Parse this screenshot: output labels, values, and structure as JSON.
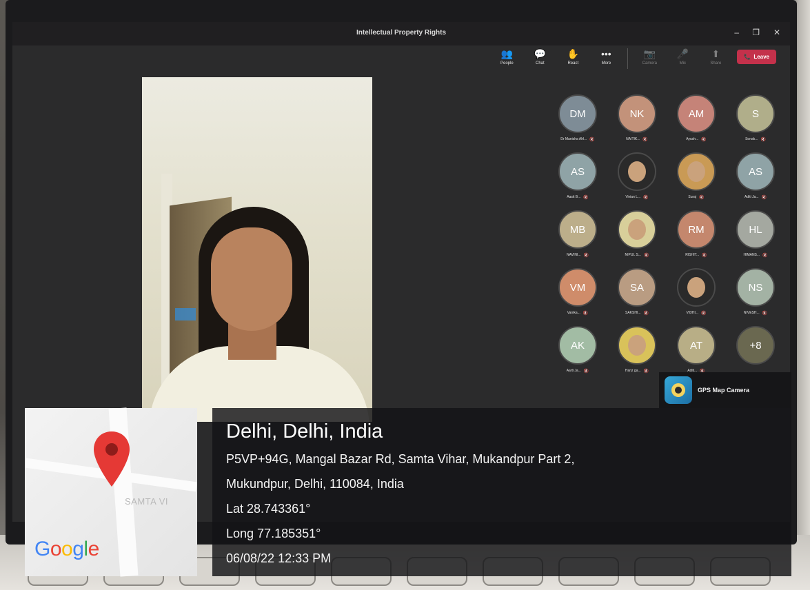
{
  "window": {
    "title": "Intellectual Property Rights",
    "minimize": "–",
    "restore": "❐",
    "close": "✕"
  },
  "toolbar": {
    "buttons": [
      {
        "icon": "people-icon",
        "glyph": "👥",
        "label": "People"
      },
      {
        "icon": "chat-icon",
        "glyph": "💬",
        "label": "Chat"
      },
      {
        "icon": "raise-hand-icon",
        "glyph": "✋",
        "label": "React"
      },
      {
        "icon": "more-icon",
        "glyph": "•••",
        "label": "More"
      },
      {
        "icon": "camera-icon",
        "glyph": "📷",
        "label": "Camera"
      },
      {
        "icon": "mic-icon",
        "glyph": "🎤",
        "label": "Mic"
      },
      {
        "icon": "share-icon",
        "glyph": "⬆",
        "label": "Share"
      }
    ],
    "leave_label": "Leave",
    "leave_color": "#c4314b"
  },
  "participants": [
    {
      "initials": "DM",
      "name": "Dr Manisha Ahl...",
      "color": "#7e8c96"
    },
    {
      "initials": "NK",
      "name": "NAITIK...",
      "color": "#c3927a"
    },
    {
      "initials": "AM",
      "name": "Ayush...",
      "color": "#c58378"
    },
    {
      "initials": "S",
      "name": "Sonak...",
      "color": "#b0ae8a"
    },
    {
      "initials": "AS",
      "name": "Aasit B...",
      "color": "#8fa3a6"
    },
    {
      "initials": "",
      "name": "Vivian L...",
      "color": "#2a2a2a",
      "photo": true
    },
    {
      "initials": "",
      "name": "Suraj",
      "color": "#c99a55",
      "photo": true
    },
    {
      "initials": "AS",
      "name": "Aditi Ja...",
      "color": "#8fa3a6"
    },
    {
      "initials": "MB",
      "name": "NAVINI...",
      "color": "#bcae8a"
    },
    {
      "initials": "",
      "name": "NIPUL S...",
      "color": "#d8cf9a",
      "photo": true
    },
    {
      "initials": "RM",
      "name": "RISHIT...",
      "color": "#c4876d"
    },
    {
      "initials": "HL",
      "name": "HIMANS...",
      "color": "#a4a8a0"
    },
    {
      "initials": "VM",
      "name": "Vanika...",
      "color": "#cf8c6a"
    },
    {
      "initials": "SA",
      "name": "SAKSHI...",
      "color": "#b99c82"
    },
    {
      "initials": "",
      "name": "VIDHI...",
      "color": "#2a2a2a",
      "photo": true
    },
    {
      "initials": "NS",
      "name": "NIVESH...",
      "color": "#a3b2a4"
    },
    {
      "initials": "AK",
      "name": "Aarti Ja...",
      "color": "#a2bca4"
    },
    {
      "initials": "",
      "name": "Hanz ga...",
      "color": "#d9c25a",
      "photo": true
    },
    {
      "initials": "AT",
      "name": "Aditi...",
      "color": "#b8ae86"
    },
    {
      "initials": "+8",
      "name": "",
      "color": "#6a6850"
    }
  ],
  "gps": {
    "app_name": "GPS Map Camera",
    "city": "Delhi, Delhi, India",
    "address_line1": "P5VP+94G, Mangal Bazar Rd, Samta Vihar, Mukandpur Part 2,",
    "address_line2": "Mukundpur, Delhi, 110084, India",
    "lat": "Lat 28.743361°",
    "long": "Long 77.185351°",
    "datetime": "06/08/22 12:33 PM",
    "map_label": "SAMTA VI",
    "map_brand": "Google",
    "pin_color": "#e53935"
  }
}
